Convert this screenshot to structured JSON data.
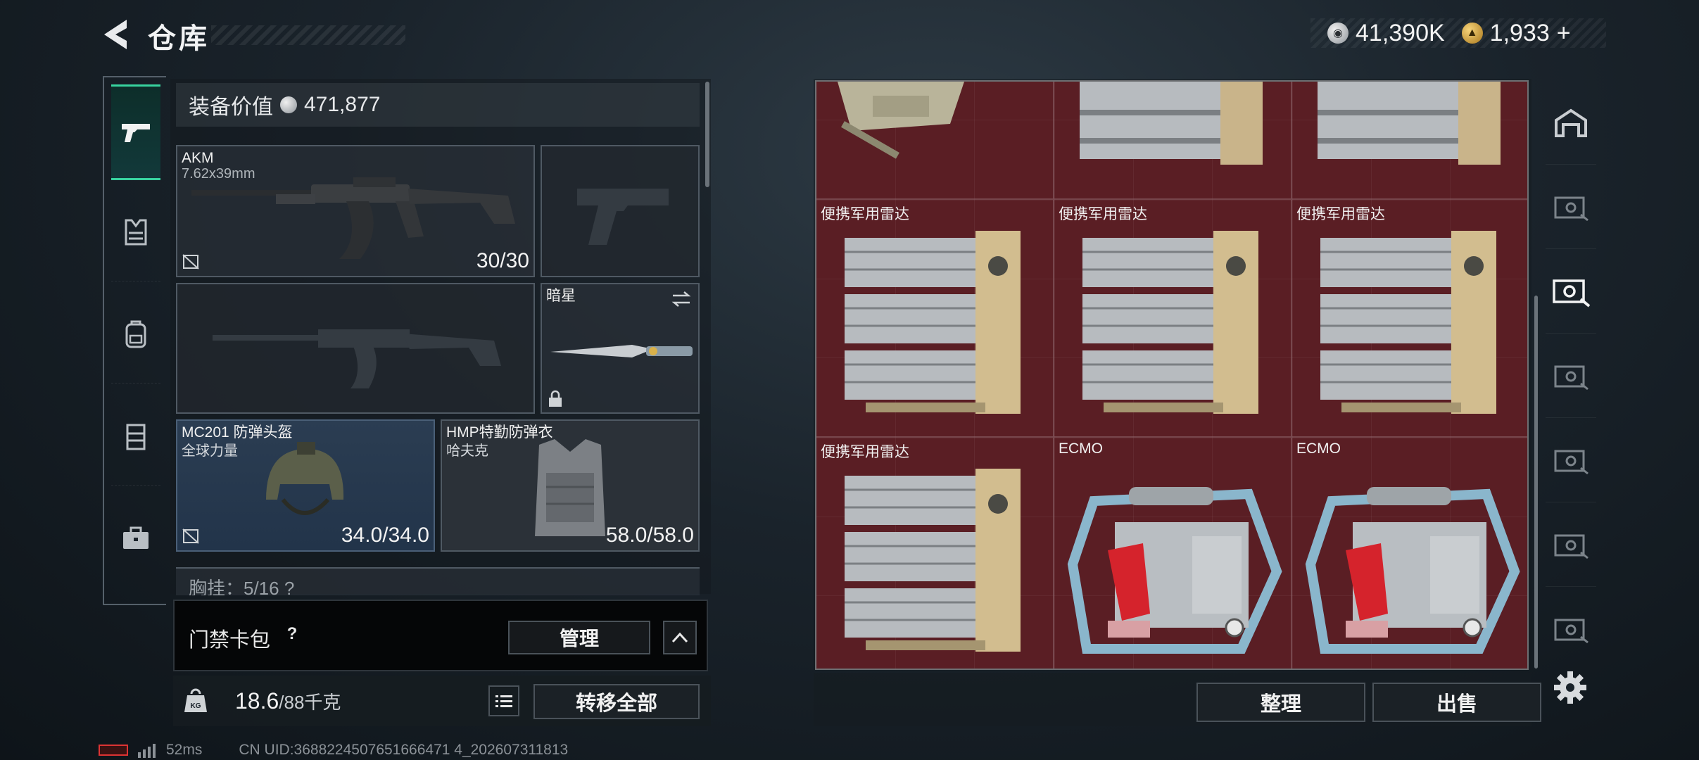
{
  "header": {
    "title": "仓库",
    "currency": [
      {
        "icon": "silver-coin-icon",
        "value": "41,390K"
      },
      {
        "icon": "gold-coin-icon",
        "value": "1,933"
      }
    ],
    "add_symbol": "+"
  },
  "left_rail": {
    "items": [
      {
        "name": "weapons-icon",
        "active": true
      },
      {
        "name": "armor-vest-icon",
        "active": false
      },
      {
        "name": "backpack-icon",
        "active": false
      },
      {
        "name": "chest-rig-icon",
        "active": false
      },
      {
        "name": "case-icon",
        "active": false
      }
    ]
  },
  "equipment": {
    "value_label": "装备价值",
    "value": "471,877",
    "slots": {
      "primary": {
        "name": "AKM",
        "caliber": "7.62x39mm",
        "durability": "30/30"
      },
      "melee": {
        "name": "暗星"
      },
      "helmet": {
        "name": "MC201 防弹头盔",
        "sub": "全球力量",
        "durability": "34.0/34.0"
      },
      "armor": {
        "name": "HMP特勤防弹衣",
        "sub": "哈夫克",
        "durability": "58.0/58.0"
      }
    },
    "chest_peek": "胸挂：5/16 ?"
  },
  "keycard": {
    "label": "门禁卡包",
    "help": "?",
    "manage_label": "管理"
  },
  "weight": {
    "current": "18.6",
    "max_unit": "/88千克",
    "transfer_label": "转移全部"
  },
  "status": {
    "ping": "52ms",
    "uid": "CN UID:3688224507651666471 4_202607311813"
  },
  "storage": {
    "cells": [
      {
        "label": ""
      },
      {
        "label": ""
      },
      {
        "label": ""
      },
      {
        "label": "便携军用雷达"
      },
      {
        "label": "便携军用雷达"
      },
      {
        "label": "便携军用雷达"
      },
      {
        "label": "便携军用雷达"
      },
      {
        "label": "ECMO"
      },
      {
        "label": "ECMO"
      }
    ],
    "tidy_label": "整理",
    "sell_label": "出售"
  },
  "colors": {
    "accent": "#38d39f",
    "storage_bg": "#5a1e24",
    "helmet_slot": "#2b3d52"
  }
}
